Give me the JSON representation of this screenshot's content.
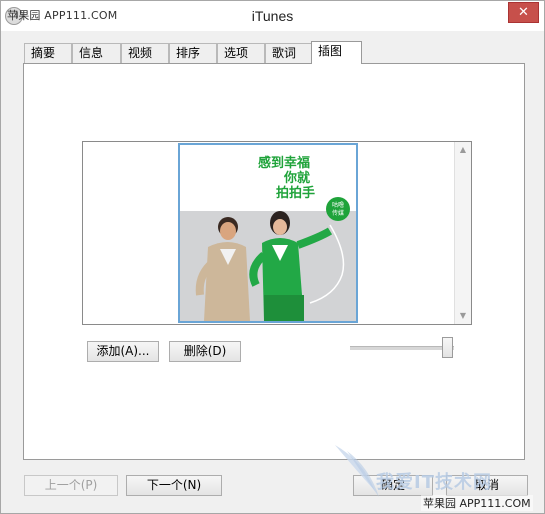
{
  "watermark_top": "苹果园 APP111.COM",
  "window": {
    "title": "iTunes",
    "close_label": "✕"
  },
  "tabs": [
    {
      "label": "摘要"
    },
    {
      "label": "信息"
    },
    {
      "label": "视频"
    },
    {
      "label": "排序"
    },
    {
      "label": "选项"
    },
    {
      "label": "歌词"
    },
    {
      "label": "插图"
    }
  ],
  "active_tab": "插图",
  "artwork": {
    "caption_lines": [
      "感到幸福",
      "你就",
      "拍拍手"
    ],
    "badge_lines": [
      "咕噜",
      "传媒"
    ],
    "colors": {
      "accent_green": "#1fa33a",
      "frame_blue": "#6aa5d6",
      "backdrop": "#d2d3d5"
    }
  },
  "actions": {
    "add_label": "添加(A)...",
    "delete_label": "删除(D)"
  },
  "zoom_slider": {
    "value": 1.0
  },
  "footer": {
    "prev_label": "上一个(P)",
    "next_label": "下一个(N)",
    "ok_label": "确定",
    "cancel_label": "取消"
  },
  "watermark_bottom": {
    "big": "我爱IT技术网",
    "small": "苹果园 APP111.COM"
  }
}
